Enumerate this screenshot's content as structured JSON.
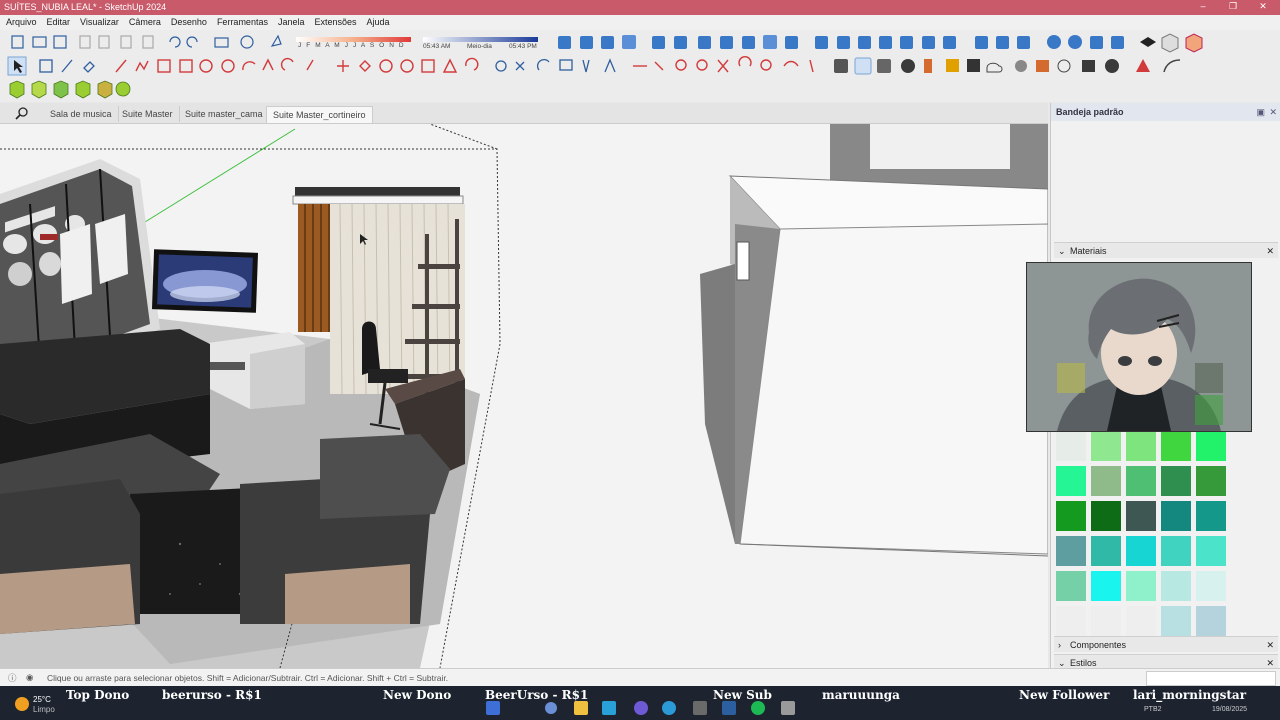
{
  "window": {
    "title": "SUÍTES_NUBIA LEAL* - SketchUp 2024",
    "controls": [
      "–",
      "❐",
      "✕"
    ]
  },
  "menu": [
    "Arquivo",
    "Editar",
    "Visualizar",
    "Câmera",
    "Desenho",
    "Ferramentas",
    "Janela",
    "Extensões",
    "Ajuda"
  ],
  "shadow_toolbar": {
    "months": "J F M A M J J A S O N D",
    "time_start": "05:43 AM",
    "time_mid": "Meio-dia",
    "time_end": "05:43 PM"
  },
  "scene_tabs": [
    {
      "label": "Sala de musica",
      "active": false
    },
    {
      "label": "Suite Master",
      "active": false
    },
    {
      "label": "Suite master_cama",
      "active": false
    },
    {
      "label": "Suite Master_cortineiro",
      "active": true
    }
  ],
  "tray": {
    "title": "Bandeja padrão",
    "materials_label": "Materiais",
    "components_label": "Componentes",
    "styles_label": "Estilos",
    "swatch_colors": [
      "#e6ece8",
      "#8fe88f",
      "#7ee47e",
      "#3fd63f",
      "#22f26a",
      "#26f596",
      "#8fba8a",
      "#4fbf74",
      "#2e8f4e",
      "#36993a",
      "#139a1f",
      "#0e6b16",
      "#3f5753",
      "#14877f",
      "#13988a",
      "#5e9ea0",
      "#30b9a7",
      "#17d5d3",
      "#3fd3c0",
      "#4be3c9",
      "#75cfa7",
      "#19f5ee",
      "#8ff0cc",
      "#b7e9e2",
      "#d6f1ee",
      "#eeeeee",
      "#eeeeee",
      "#eeeeee",
      "#b8e0e2",
      "#b5d3dd"
    ]
  },
  "status": {
    "text": "Clique ou arraste para selecionar objetos. Shift = Adicionar/Subtrair. Ctrl = Adicionar. Shift + Ctrl = Subtrair."
  },
  "taskbar": {
    "weather_temp": "25°C",
    "weather_desc": "Limpo",
    "lang": "PTB2",
    "date": "19/08/2025",
    "ticker": [
      {
        "label": "Top Dono",
        "value": "beerurso - R$1"
      },
      {
        "label": "New Dono",
        "value": "BeerUrso - R$1"
      },
      {
        "label": "New Sub",
        "value": "maruuunga"
      },
      {
        "label": "New Follower",
        "value": "lari_morningstar"
      }
    ]
  },
  "colors": {
    "titlebar": "#c95a6a",
    "tray_header": "#e2e6ee",
    "taskbar": "#1d2430"
  }
}
